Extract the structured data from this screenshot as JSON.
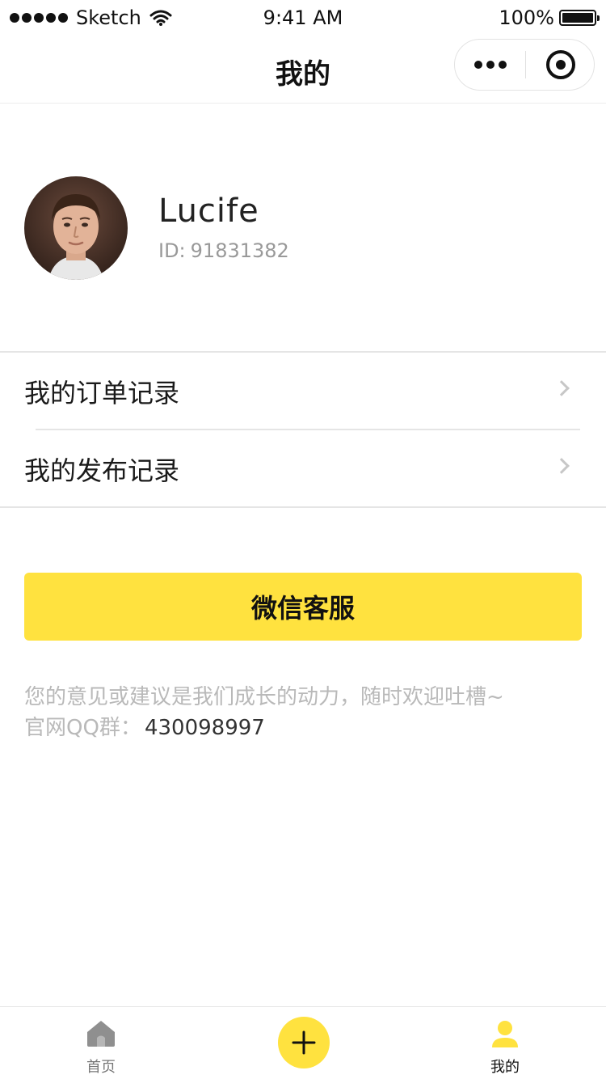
{
  "status_bar": {
    "carrier": "Sketch",
    "time": "9:41 AM",
    "battery": "100%",
    "signal_icon": "signal-dots-icon",
    "wifi_icon": "wifi-icon",
    "battery_icon": "battery-icon"
  },
  "nav": {
    "title": "我的",
    "more_icon": "more-dots-icon",
    "close_icon": "target-circle-icon"
  },
  "profile": {
    "username": "Lucife",
    "id_label": "ID:",
    "id_value": "91831382",
    "avatar_icon": "user-avatar-photo"
  },
  "menu": {
    "items": [
      {
        "label": "我的订单记录",
        "icon": "chevron-right-icon"
      },
      {
        "label": "我的发布记录",
        "icon": "chevron-right-icon"
      }
    ]
  },
  "service_button": {
    "label": "微信客服"
  },
  "feedback": {
    "text": "您的意见或建议是我们成长的动力，随时欢迎吐槽~",
    "qq_label": "官网QQ群：",
    "qq_number": "430098997"
  },
  "tab_bar": {
    "items": [
      {
        "label": "首页",
        "icon": "home-icon"
      },
      {
        "label": "",
        "icon": "plus-icon"
      },
      {
        "label": "我的",
        "icon": "user-icon"
      }
    ],
    "active": "我的"
  },
  "colors": {
    "accent": "#ffe23f",
    "divider": "#e5e5e5",
    "muted_text": "#b9b9b9"
  }
}
